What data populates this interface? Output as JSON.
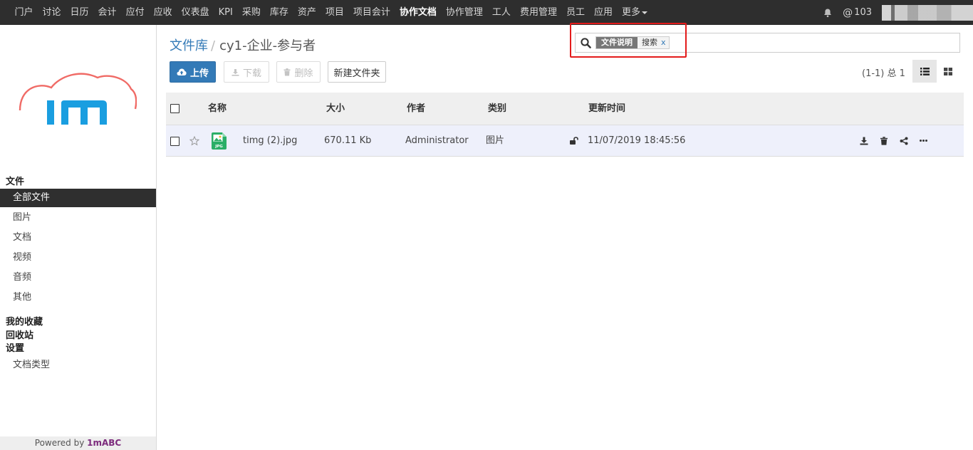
{
  "nav": {
    "items": [
      {
        "label": "门户"
      },
      {
        "label": "讨论"
      },
      {
        "label": "日历"
      },
      {
        "label": "会计"
      },
      {
        "label": "应付"
      },
      {
        "label": "应收"
      },
      {
        "label": "仪表盘"
      },
      {
        "label": "KPI"
      },
      {
        "label": "采购"
      },
      {
        "label": "库存"
      },
      {
        "label": "资产"
      },
      {
        "label": "项目"
      },
      {
        "label": "项目会计"
      },
      {
        "label": "协作文档"
      },
      {
        "label": "协作管理"
      },
      {
        "label": "工人"
      },
      {
        "label": "费用管理"
      },
      {
        "label": "员工"
      },
      {
        "label": "应用"
      },
      {
        "label": "更多"
      }
    ],
    "active_index": 13,
    "bell_icon": "bell-icon",
    "mention_symbol": "@",
    "mention_count": "103"
  },
  "sidebar": {
    "logo_text": "1m",
    "section_files": "文件",
    "items": [
      {
        "label": "全部文件"
      },
      {
        "label": "图片"
      },
      {
        "label": "文档"
      },
      {
        "label": "视频"
      },
      {
        "label": "音频"
      },
      {
        "label": "其他"
      }
    ],
    "favorites": "我的收藏",
    "recycle": "回收站",
    "settings": "设置",
    "doc_types": "文档类型",
    "powered_prefix": "Powered by ",
    "powered_brand": "1mABC"
  },
  "breadcrumb": {
    "root": "文件库",
    "separator": "/",
    "current": "cy1-企业-参与者"
  },
  "search": {
    "facet_name": "文件说明",
    "facet_value": "搜索",
    "facet_remove": "x"
  },
  "toolbar": {
    "upload": "上传",
    "download": "下载",
    "delete": "删除",
    "new_folder": "新建文件夹"
  },
  "pager": "(1-1) 总 1",
  "table": {
    "columns": {
      "name": "名称",
      "size": "大小",
      "author": "作者",
      "type": "类别",
      "updated": "更新时间"
    },
    "rows": [
      {
        "file_badge": "JPG",
        "name": "timg (2).jpg",
        "size": "670.11 Kb",
        "author": "Administrator",
        "type": "图片",
        "updated": "11/07/2019 18:45:56"
      }
    ]
  },
  "colors": {
    "accent": "#337ab7",
    "topbar": "#2e2e2e",
    "highlight": "#e31b1b",
    "brand": "#7c2a7c"
  }
}
